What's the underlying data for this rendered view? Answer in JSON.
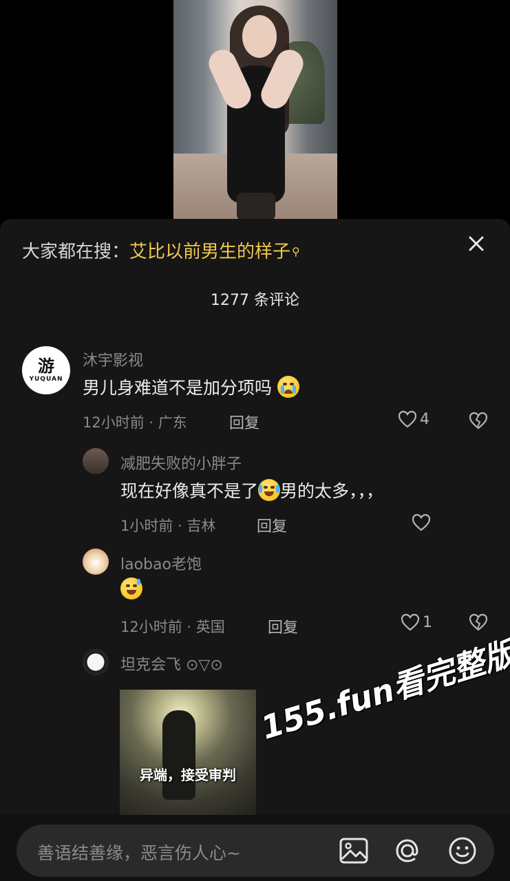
{
  "search": {
    "prefix": "大家都在搜：",
    "term": "艾比以前男生的样子",
    "icon": "search-icon"
  },
  "close_icon": "close-icon",
  "comment_count_label": "1277 条评论",
  "comments": [
    {
      "username": "沐宇影视",
      "avatar_logo": "YUQUAN",
      "avatar_mark": "游",
      "text": "男儿身难道不是加分项吗",
      "emoji": "crying-emoji",
      "meta": "12小时前 · 广东",
      "reply_label": "回复",
      "likes": "4"
    }
  ],
  "replies": [
    {
      "username": "减肥失败的小胖子",
      "text_before": "现在好像真不是了",
      "emoji": "laugh-cry-emoji",
      "text_after": "男的太多，，，",
      "meta": "1小时前 · 吉林",
      "reply_label": "回复"
    },
    {
      "username": "laobao老饱",
      "emoji": "sweat-smile-emoji",
      "meta": "12小时前 · 英国",
      "reply_label": "回复",
      "likes": "1"
    },
    {
      "username": "坦克会飞 ⊙▽⊙",
      "image_caption": "异端，接受审判"
    }
  ],
  "watermark": "155.fun看完整版",
  "input": {
    "placeholder": "善语结善缘，恶言伤人心~"
  },
  "toolbar_icons": [
    "image-icon",
    "at-icon",
    "emoji-icon"
  ],
  "colors": {
    "accent": "#f2c94c",
    "sheet_bg": "#161616",
    "muted_text": "#8a8a8a"
  }
}
